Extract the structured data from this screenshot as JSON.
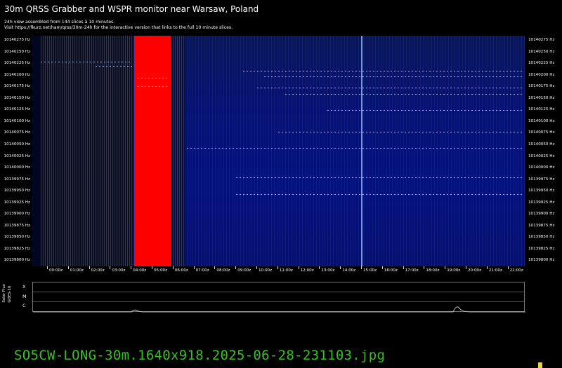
{
  "title": "30m QRSS Grabber and WSPR monitor near Warsaw, Poland",
  "subtitle_line1": "24h view assembled from 144 slices à 10 minutes.",
  "subtitle_line2": "Visit https://fkurz.net/ham/qrss/30m-24h for the interactive version that links to the full 10 minute slices.",
  "y_axis": {
    "labels": [
      "10140275 Hz",
      "10140250 Hz",
      "10140225 Hz",
      "10140200 Hz",
      "10140175 Hz",
      "10140150 Hz",
      "10140125 Hz",
      "10140100 Hz",
      "10140075 Hz",
      "10140050 Hz",
      "10140025 Hz",
      "10140000 Hz",
      "10139975 Hz",
      "10139950 Hz",
      "10139925 Hz",
      "10139900 Hz",
      "10139875 Hz",
      "10139850 Hz",
      "10139825 Hz",
      "10139800 Hz"
    ]
  },
  "x_axis": {
    "labels": [
      "00:00z",
      "01:00z",
      "02:00z",
      "03:00z",
      "04:00z",
      "05:00z",
      "06:00z",
      "07:00z",
      "08:00z",
      "09:00z",
      "10:00z",
      "11:00z",
      "12:00z",
      "13:00z",
      "14:00z",
      "15:00z",
      "16:00z",
      "17:00z",
      "18:00z",
      "19:00z",
      "20:00z",
      "21:00z",
      "22:00z"
    ]
  },
  "solar_flux": {
    "side_label_1": "Solar Flux",
    "side_label_2": "GOES-16",
    "classes": [
      "X",
      "M",
      "C"
    ]
  },
  "filename": "SO5CW-LONG-30m.1640x918.2025-06-28-231103.jpg",
  "colors": {
    "background": "#000000",
    "filename_green": "#39c024",
    "gap_red": "#ff0000",
    "spectrogram_blue": "#05107a"
  }
}
